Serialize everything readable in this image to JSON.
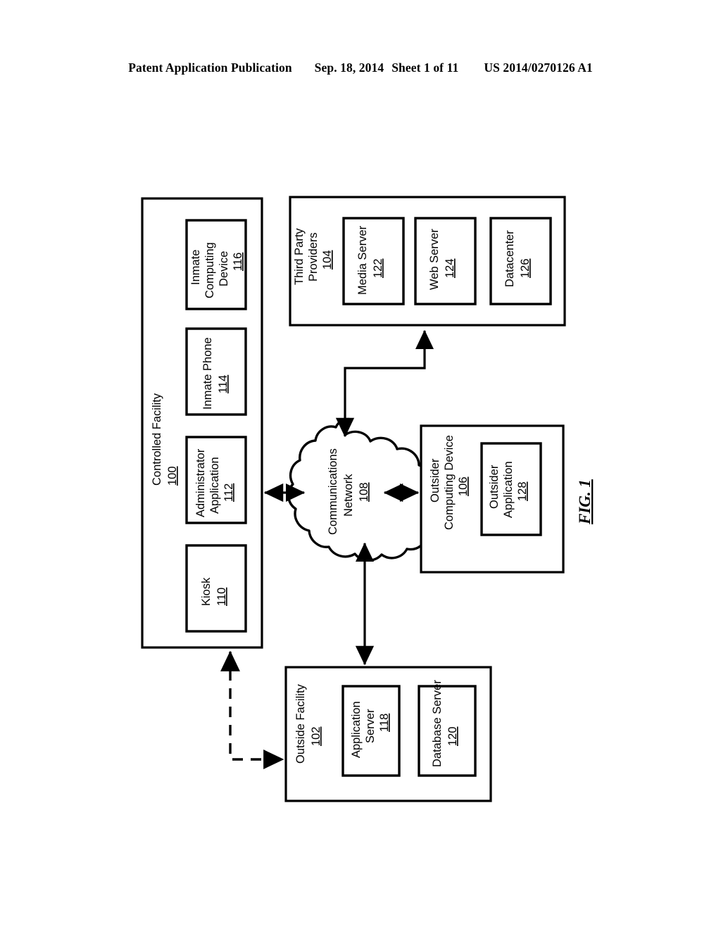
{
  "header": {
    "publication": "Patent Application Publication",
    "date": "Sep. 18, 2014",
    "sheet": "Sheet 1 of 11",
    "patent_number": "US 2014/0270126 A1"
  },
  "figure": {
    "label": "FIG. 1"
  },
  "diagram": {
    "controlled_facility": {
      "label": "Controlled Facility",
      "ref": "100",
      "children": [
        {
          "label": "Kiosk",
          "ref": "110"
        },
        {
          "label_line1": "Administrator",
          "label_line2": "Application",
          "ref": "112"
        },
        {
          "label": "Inmate Phone",
          "ref": "114"
        },
        {
          "label_line1": "Inmate",
          "label_line2": "Computing",
          "label_line3": "Device",
          "ref": "116"
        }
      ]
    },
    "third_party_providers": {
      "label_line1": "Third Party",
      "label_line2": "Providers",
      "ref": "104",
      "children": [
        {
          "label": "Media Server",
          "ref": "122"
        },
        {
          "label": "Web Server",
          "ref": "124"
        },
        {
          "label": "Datacenter",
          "ref": "126"
        }
      ]
    },
    "communications_network": {
      "label_line1": "Communications",
      "label_line2": "Network",
      "ref": "108"
    },
    "outsider_computing_device": {
      "label_line1": "Outsider",
      "label_line2": "Computing Device",
      "ref": "106",
      "children": [
        {
          "label_line1": "Outsider",
          "label_line2": "Application",
          "ref": "128"
        }
      ]
    },
    "outside_facility": {
      "label": "Outside Facility",
      "ref": "102",
      "children": [
        {
          "label_line1": "Application",
          "label_line2": "Server",
          "ref": "118"
        },
        {
          "label": "Database Server",
          "ref": "120"
        }
      ]
    },
    "connectors": [
      {
        "name": "facility-to-network",
        "style": "solid",
        "arrows": "both"
      },
      {
        "name": "network-to-third-party",
        "style": "solid",
        "arrows": "both"
      },
      {
        "name": "network-to-outsider",
        "style": "solid",
        "arrows": "both"
      },
      {
        "name": "network-to-outside-facility",
        "style": "solid",
        "arrows": "both"
      },
      {
        "name": "controlled-facility-to-outside-facility",
        "style": "dashed",
        "arrows": "both"
      }
    ]
  }
}
